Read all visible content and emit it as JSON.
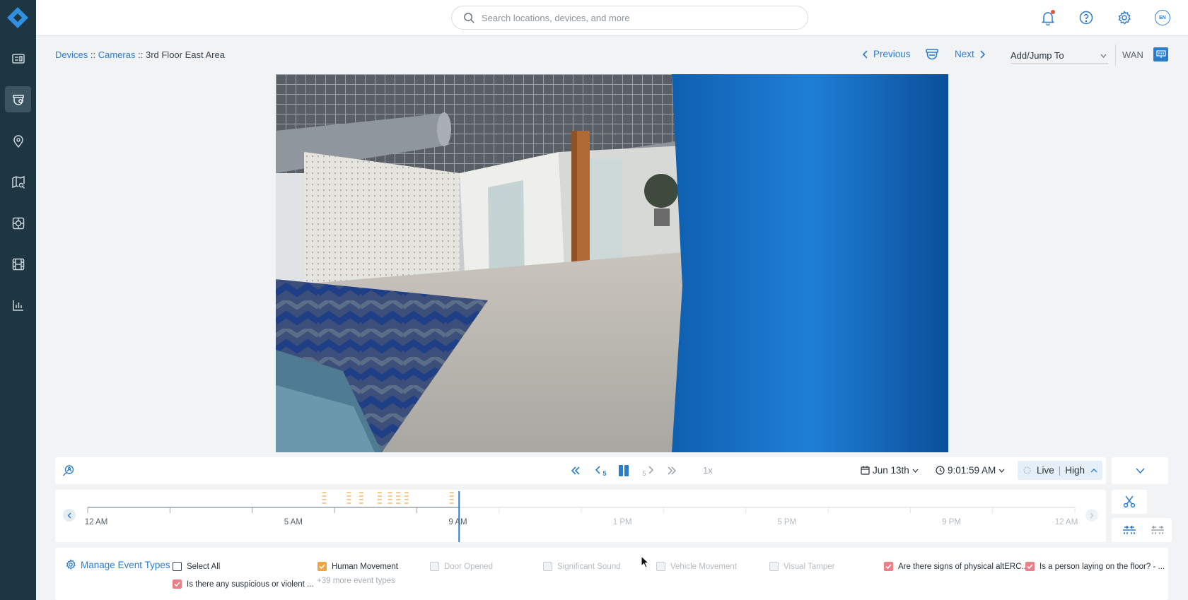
{
  "search": {
    "placeholder": "Search locations, devices, and more"
  },
  "topbar": {
    "language": "EN"
  },
  "breadcrumb": {
    "items": [
      "Devices",
      "Cameras"
    ],
    "separator": "::",
    "current": "3rd Floor East Area"
  },
  "navigation": {
    "previous_label": "Previous",
    "next_label": "Next",
    "add_jump_label": "Add/Jump To",
    "network_label": "WAN"
  },
  "controls": {
    "rewind_step": "5",
    "forward_step": "5",
    "speed": "1x",
    "date": "Jun 13th",
    "time": "9:01:59 AM",
    "mode": "Live",
    "quality": "High"
  },
  "timeline": {
    "labels": [
      "12 AM",
      "5 AM",
      "9 AM",
      "1 PM",
      "5 PM",
      "9 PM",
      "12 AM"
    ],
    "playhead_hour": 9.03
  },
  "events": {
    "manage_label": "Manage Event Types",
    "items": [
      {
        "label": "Select All",
        "checked": false,
        "enabled": true
      },
      {
        "label": "Human Movement",
        "checked": true,
        "enabled": true,
        "color": "#f2a33a"
      },
      {
        "label": "Door Opened",
        "checked": false,
        "enabled": false
      },
      {
        "label": "Significant Sound",
        "checked": false,
        "enabled": false
      },
      {
        "label": "Vehicle Movement",
        "checked": false,
        "enabled": false
      },
      {
        "label": "Visual Tamper",
        "checked": false,
        "enabled": false
      },
      {
        "label": "Are there signs of physical altERC...",
        "checked": true,
        "enabled": true,
        "color": "#eb7f88"
      },
      {
        "label": "Is a person laying on the floor? - ...",
        "checked": true,
        "enabled": true,
        "color": "#eb7f88"
      },
      {
        "label": "Is there any suspicious or violent ...",
        "checked": true,
        "enabled": true,
        "color": "#eb7f88"
      }
    ],
    "more_label": "+39 more event types"
  },
  "colors": {
    "accent": "#2c7ccd",
    "sidebar": "#1e3642",
    "human_movement": "#f2a33a",
    "custom_event": "#eb7f88"
  }
}
